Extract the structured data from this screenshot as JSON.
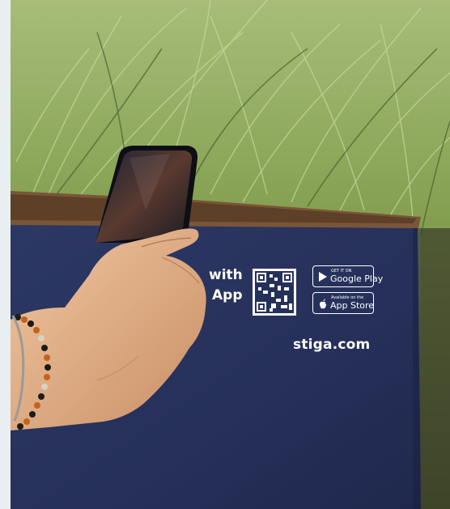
{
  "box": {
    "partial_text_line1": "with",
    "partial_text_line2": "App",
    "website": "stiga.com"
  },
  "badges": {
    "google": {
      "small": "GET IT ON",
      "large": "Google Play"
    },
    "apple": {
      "small": "Available on the",
      "large": "App Store"
    }
  },
  "colors": {
    "box_navy": "#25305a",
    "grass_green": "#7e9a4a",
    "cardboard": "#7a5538",
    "skin": "#e6b68f"
  }
}
